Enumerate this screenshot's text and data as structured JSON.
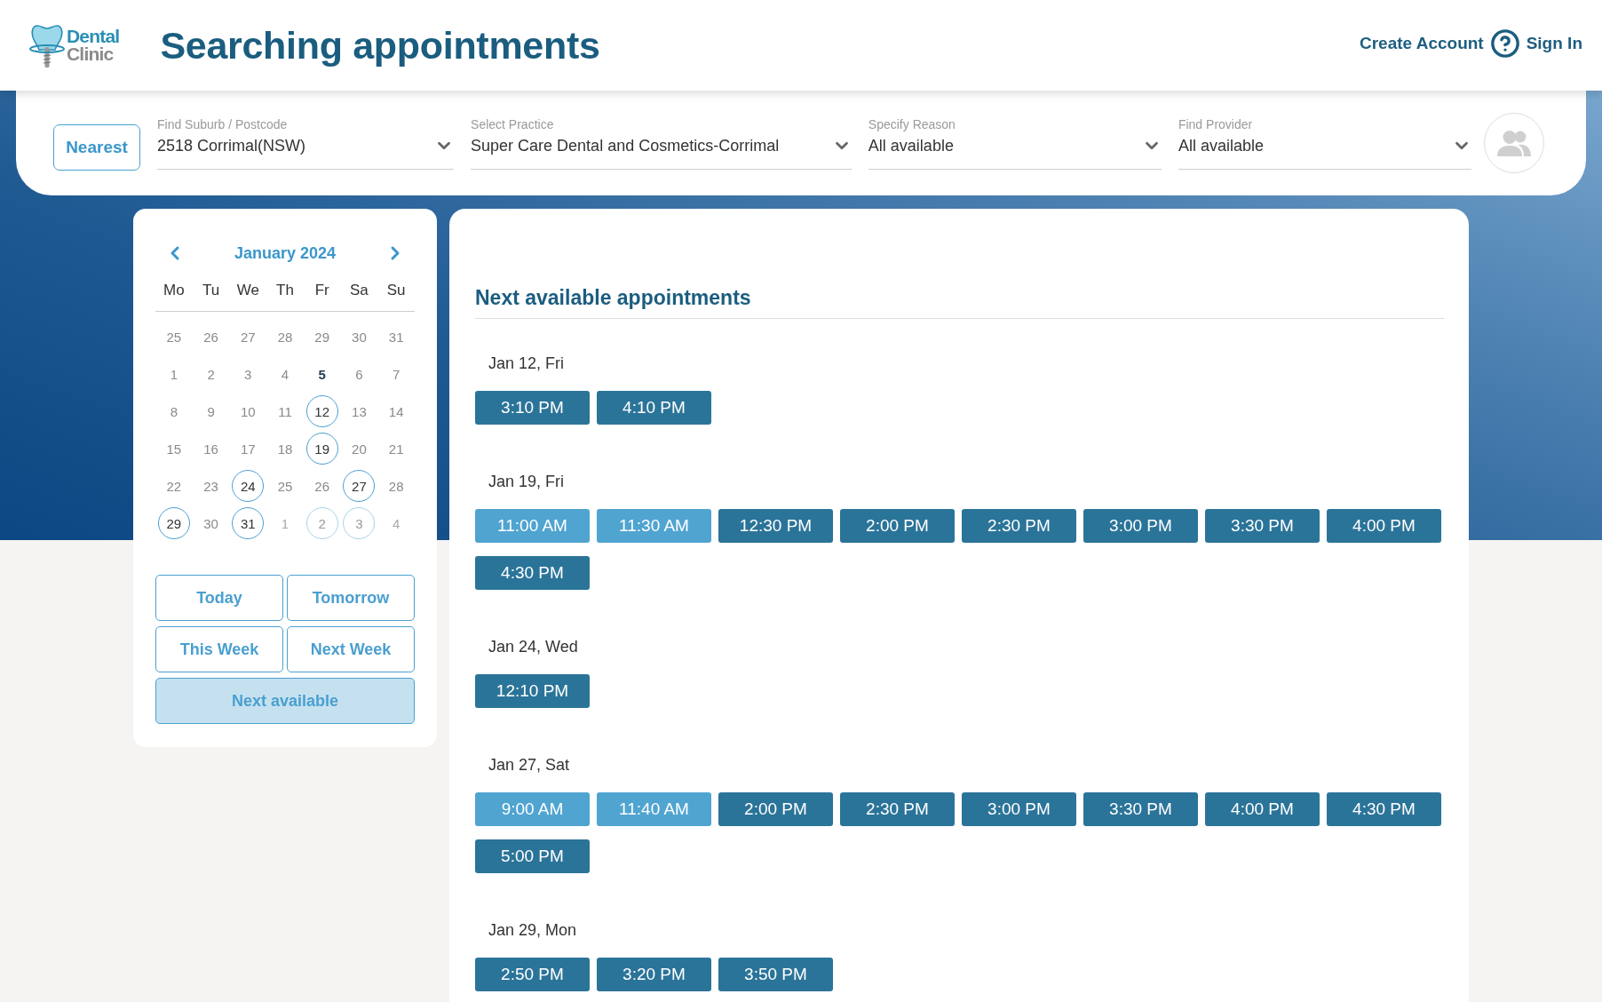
{
  "header": {
    "logo": {
      "line_1": "Dental",
      "line_2": "Clinic"
    },
    "title": "Searching appointments",
    "nav": {
      "create_account": "Create Account",
      "sign_in": "Sign In"
    }
  },
  "filters": {
    "nearest_button": "Nearest",
    "fields": [
      {
        "label": "Find Suburb / Postcode",
        "value": "2518 Corrimal(NSW)"
      },
      {
        "label": "Select Practice",
        "value": "Super Care Dental and Cosmetics-Corrimal"
      },
      {
        "label": "Specify Reason",
        "value": "All available"
      },
      {
        "label": "Find Provider",
        "value": "All available"
      }
    ]
  },
  "calendar": {
    "month": "January 2024",
    "weekdays": [
      "Mo",
      "Tu",
      "We",
      "Th",
      "Fr",
      "Sa",
      "Su"
    ],
    "weeks": [
      [
        {
          "day": "25",
          "available": false,
          "today": false,
          "dimmed": false
        },
        {
          "day": "26",
          "available": false,
          "today": false,
          "dimmed": false
        },
        {
          "day": "27",
          "available": false,
          "today": false,
          "dimmed": false
        },
        {
          "day": "28",
          "available": false,
          "today": false,
          "dimmed": false
        },
        {
          "day": "29",
          "available": false,
          "today": false,
          "dimmed": false
        },
        {
          "day": "30",
          "available": false,
          "today": false,
          "dimmed": false
        },
        {
          "day": "31",
          "available": false,
          "today": false,
          "dimmed": false
        }
      ],
      [
        {
          "day": "1",
          "available": false,
          "today": false,
          "dimmed": false
        },
        {
          "day": "2",
          "available": false,
          "today": false,
          "dimmed": false
        },
        {
          "day": "3",
          "available": false,
          "today": false,
          "dimmed": false
        },
        {
          "day": "4",
          "available": false,
          "today": false,
          "dimmed": false
        },
        {
          "day": "5",
          "available": false,
          "today": true,
          "dimmed": false
        },
        {
          "day": "6",
          "available": false,
          "today": false,
          "dimmed": false
        },
        {
          "day": "7",
          "available": false,
          "today": false,
          "dimmed": false
        }
      ],
      [
        {
          "day": "8",
          "available": false,
          "today": false,
          "dimmed": false
        },
        {
          "day": "9",
          "available": false,
          "today": false,
          "dimmed": false
        },
        {
          "day": "10",
          "available": false,
          "today": false,
          "dimmed": false
        },
        {
          "day": "11",
          "available": false,
          "today": false,
          "dimmed": false
        },
        {
          "day": "12",
          "available": true,
          "today": false,
          "dimmed": false
        },
        {
          "day": "13",
          "available": false,
          "today": false,
          "dimmed": false
        },
        {
          "day": "14",
          "available": false,
          "today": false,
          "dimmed": false
        }
      ],
      [
        {
          "day": "15",
          "available": false,
          "today": false,
          "dimmed": false
        },
        {
          "day": "16",
          "available": false,
          "today": false,
          "dimmed": false
        },
        {
          "day": "17",
          "available": false,
          "today": false,
          "dimmed": false
        },
        {
          "day": "18",
          "available": false,
          "today": false,
          "dimmed": false
        },
        {
          "day": "19",
          "available": true,
          "today": false,
          "dimmed": false
        },
        {
          "day": "20",
          "available": false,
          "today": false,
          "dimmed": false
        },
        {
          "day": "21",
          "available": false,
          "today": false,
          "dimmed": false
        }
      ],
      [
        {
          "day": "22",
          "available": false,
          "today": false,
          "dimmed": false
        },
        {
          "day": "23",
          "available": false,
          "today": false,
          "dimmed": false
        },
        {
          "day": "24",
          "available": true,
          "today": false,
          "dimmed": false
        },
        {
          "day": "25",
          "available": false,
          "today": false,
          "dimmed": false
        },
        {
          "day": "26",
          "available": false,
          "today": false,
          "dimmed": false
        },
        {
          "day": "27",
          "available": true,
          "today": false,
          "dimmed": false
        },
        {
          "day": "28",
          "available": false,
          "today": false,
          "dimmed": false
        }
      ],
      [
        {
          "day": "29",
          "available": true,
          "today": false,
          "dimmed": false
        },
        {
          "day": "30",
          "available": false,
          "today": false,
          "dimmed": false
        },
        {
          "day": "31",
          "available": true,
          "today": false,
          "dimmed": false
        },
        {
          "day": "1",
          "available": false,
          "today": false,
          "dimmed": true
        },
        {
          "day": "2",
          "available": true,
          "today": false,
          "dimmed": true
        },
        {
          "day": "3",
          "available": true,
          "today": false,
          "dimmed": true
        },
        {
          "day": "4",
          "available": false,
          "today": false,
          "dimmed": true
        }
      ]
    ],
    "quick_buttons": [
      {
        "label": "Today",
        "selected": false
      },
      {
        "label": "Tomorrow",
        "selected": false
      },
      {
        "label": "This Week",
        "selected": false
      },
      {
        "label": "Next Week",
        "selected": false
      },
      {
        "label": "Next available",
        "selected": true
      }
    ]
  },
  "appointments": {
    "heading": "Next available appointments",
    "days": [
      {
        "date": "Jan 12, Fri",
        "slots": [
          {
            "time": "3:10 PM",
            "highlighted": false
          },
          {
            "time": "4:10 PM",
            "highlighted": false
          }
        ]
      },
      {
        "date": "Jan 19, Fri",
        "slots": [
          {
            "time": "11:00 AM",
            "highlighted": true
          },
          {
            "time": "11:30 AM",
            "highlighted": true
          },
          {
            "time": "12:30 PM",
            "highlighted": false
          },
          {
            "time": "2:00 PM",
            "highlighted": false
          },
          {
            "time": "2:30 PM",
            "highlighted": false
          },
          {
            "time": "3:00 PM",
            "highlighted": false
          },
          {
            "time": "3:30 PM",
            "highlighted": false
          },
          {
            "time": "4:00 PM",
            "highlighted": false
          },
          {
            "time": "4:30 PM",
            "highlighted": false
          }
        ]
      },
      {
        "date": "Jan 24, Wed",
        "slots": [
          {
            "time": "12:10 PM",
            "highlighted": false
          }
        ]
      },
      {
        "date": "Jan 27, Sat",
        "slots": [
          {
            "time": "9:00 AM",
            "highlighted": true
          },
          {
            "time": "11:40 AM",
            "highlighted": true
          },
          {
            "time": "2:00 PM",
            "highlighted": false
          },
          {
            "time": "2:30 PM",
            "highlighted": false
          },
          {
            "time": "3:00 PM",
            "highlighted": false
          },
          {
            "time": "3:30 PM",
            "highlighted": false
          },
          {
            "time": "4:00 PM",
            "highlighted": false
          },
          {
            "time": "4:30 PM",
            "highlighted": false
          },
          {
            "time": "5:00 PM",
            "highlighted": false
          }
        ]
      },
      {
        "date": "Jan 29, Mon",
        "slots": [
          {
            "time": "2:50 PM",
            "highlighted": false
          },
          {
            "time": "3:20 PM",
            "highlighted": false
          },
          {
            "time": "3:50 PM",
            "highlighted": false
          }
        ]
      }
    ]
  }
}
